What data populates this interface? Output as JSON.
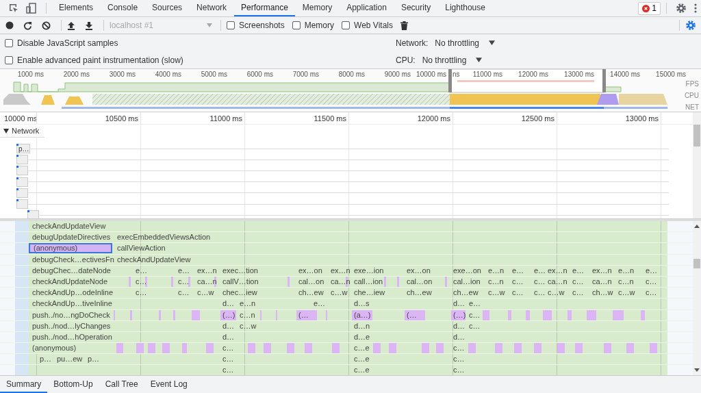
{
  "tabs": [
    {
      "label": "Elements",
      "selected": false
    },
    {
      "label": "Console",
      "selected": false
    },
    {
      "label": "Sources",
      "selected": false
    },
    {
      "label": "Network",
      "selected": false
    },
    {
      "label": "Performance",
      "selected": true
    },
    {
      "label": "Memory",
      "selected": false
    },
    {
      "label": "Application",
      "selected": false
    },
    {
      "label": "Security",
      "selected": false
    },
    {
      "label": "Lighthouse",
      "selected": false
    }
  ],
  "error_badge": {
    "count": "1"
  },
  "toolbar": {
    "target": {
      "value": "localhost #1",
      "disabled": true
    },
    "options": [
      {
        "label": "Screenshots",
        "checked": false
      },
      {
        "label": "Memory",
        "checked": false
      },
      {
        "label": "Web Vitals",
        "checked": false
      }
    ]
  },
  "settings": {
    "options": [
      {
        "label": "Disable JavaScript samples",
        "checked": false
      },
      {
        "label": "Enable advanced paint instrumentation (slow)",
        "checked": false
      }
    ],
    "network": {
      "label": "Network:",
      "value": "No throttling"
    },
    "cpu": {
      "label": "CPU:",
      "value": "No throttling"
    }
  },
  "overview": {
    "ticks": [
      "1000 ms",
      "2000 ms",
      "3000 ms",
      "4000 ms",
      "5000 ms",
      "6000 ms",
      "7000 ms",
      "8000 ms",
      "9000 ms",
      "10000 ms",
      "11000 ms",
      "12000 ms",
      "13000 ms",
      "14000 ms",
      "15000 ms"
    ],
    "window_tick": "ns",
    "lanes": [
      "FPS",
      "CPU",
      "NET"
    ]
  },
  "timeline": {
    "ticks": [
      "10000 ms",
      "10500 ms",
      "11000 ms",
      "11500 ms",
      "12000 ms",
      "12500 ms",
      "13000 ms"
    ]
  },
  "network_track": {
    "label": "Network",
    "expanded": true,
    "requests": [
      "p…"
    ]
  },
  "flame_rows": [
    {
      "name": "checkAndUpdateView",
      "selected": false
    },
    {
      "name": "debugUpdateDirectives",
      "selected": false,
      "entries": [
        {
          "text": "execEmbeddedViewsAction"
        }
      ]
    },
    {
      "name": "(anonymous)",
      "selected": true,
      "color": "#d4b4f4",
      "entries": [
        {
          "text": "callViewAction"
        }
      ]
    },
    {
      "name": "debugCheck…ectivesFn",
      "selected": false,
      "entries": [
        {
          "text": "checkAndUpdateView"
        }
      ]
    },
    {
      "name": "debugChec…dateNode",
      "selected": false,
      "entries": [
        {
          "text": "e…"
        },
        {
          "text": "e…"
        },
        {
          "text": "ex…n"
        },
        {
          "text": "exec…tion"
        },
        {
          "text": "ex…on"
        },
        {
          "text": "ex…n"
        },
        {
          "text": "exe…ion"
        },
        {
          "text": "ex…on"
        },
        {
          "text": "exe…on"
        },
        {
          "text": "e…n"
        },
        {
          "text": "e…"
        },
        {
          "text": "e…"
        },
        {
          "text": "ex…n"
        },
        {
          "text": "e…"
        },
        {
          "text": "ex…n"
        },
        {
          "text": "e…n"
        },
        {
          "text": "e…"
        }
      ]
    },
    {
      "name": "checkAndUpdateNode",
      "selected": false,
      "entries": [
        {
          "text": "c…"
        },
        {
          "text": "c…"
        },
        {
          "text": "ca…n"
        },
        {
          "text": "callV…tion"
        },
        {
          "text": "cal…on"
        },
        {
          "text": "ca…n"
        },
        {
          "text": "call…ion"
        },
        {
          "text": "cal…on"
        },
        {
          "text": "cal…ion"
        },
        {
          "text": "c…n"
        },
        {
          "text": "c…"
        },
        {
          "text": "c…"
        },
        {
          "text": "ca…n"
        },
        {
          "text": "c…"
        },
        {
          "text": "ca…n"
        },
        {
          "text": "c…n"
        },
        {
          "text": "c…"
        }
      ]
    },
    {
      "name": "checkAndUp…odeInline",
      "selected": false,
      "entries": [
        {
          "text": "c…"
        },
        {
          "text": "c…"
        },
        {
          "text": "c…w"
        },
        {
          "text": "chec…iew"
        },
        {
          "text": "ch…ew"
        },
        {
          "text": "c…w"
        },
        {
          "text": "che…iew"
        },
        {
          "text": "ch…ew"
        },
        {
          "text": "ch…ew"
        },
        {
          "text": "c…w"
        },
        {
          "text": "c…"
        },
        {
          "text": "c…"
        },
        {
          "text": "c…w"
        },
        {
          "text": "c…"
        },
        {
          "text": "ch…w"
        },
        {
          "text": "c…w"
        },
        {
          "text": "c…"
        }
      ]
    },
    {
      "name": "checkAndUp…tiveInline",
      "selected": false,
      "entries": [
        {
          "text": "d…"
        },
        {
          "text": "e…n"
        },
        {
          "text": "e…"
        },
        {
          "text": "d…s"
        },
        {
          "text": "d…"
        },
        {
          "text": "e…"
        }
      ]
    },
    {
      "name": "push../no…ngDoCheck",
      "selected": false,
      "entries": [
        {
          "text": "(…)",
          "color": "#dcb6f4"
        },
        {
          "text": "c…n"
        },
        {
          "text": "(…",
          "color": "#dcb6f4"
        },
        {
          "text": "(a…)",
          "color": "#dcb6f4"
        },
        {
          "text": "(…",
          "color": "#dcb6f4"
        },
        {
          "text": "(…)",
          "color": "#dcb6f4"
        },
        {
          "text": "c…"
        }
      ]
    },
    {
      "name": "push../nod…lyChanges",
      "selected": false,
      "entries": [
        {
          "text": "d…"
        },
        {
          "text": "c…w"
        },
        {
          "text": "d…n"
        },
        {
          "text": "d…"
        },
        {
          "text": "c…"
        }
      ]
    },
    {
      "name": "push../nod…hOperation",
      "selected": false,
      "entries": [
        {
          "text": "d…"
        },
        {
          "text": "d…e"
        },
        {
          "text": "d…"
        }
      ]
    },
    {
      "name": "(anonymous)",
      "selected": false,
      "entries": [
        {
          "text": "c…"
        },
        {
          "text": "c…e"
        },
        {
          "text": "c…"
        }
      ]
    },
    {
      "entries": [
        {
          "text": "p…"
        },
        {
          "text": "pu…ew"
        },
        {
          "text": "p…"
        },
        {
          "text": "c…"
        },
        {
          "text": "c…e"
        },
        {
          "text": "c…"
        }
      ]
    },
    {
      "entries": [
        {
          "text": "c…"
        },
        {
          "text": "c…e"
        },
        {
          "text": "c…"
        }
      ]
    }
  ],
  "bottom_tabs": [
    {
      "label": "Summary",
      "selected": true
    },
    {
      "label": "Bottom-Up",
      "selected": false
    },
    {
      "label": "Call Tree",
      "selected": false
    },
    {
      "label": "Event Log",
      "selected": false
    }
  ]
}
